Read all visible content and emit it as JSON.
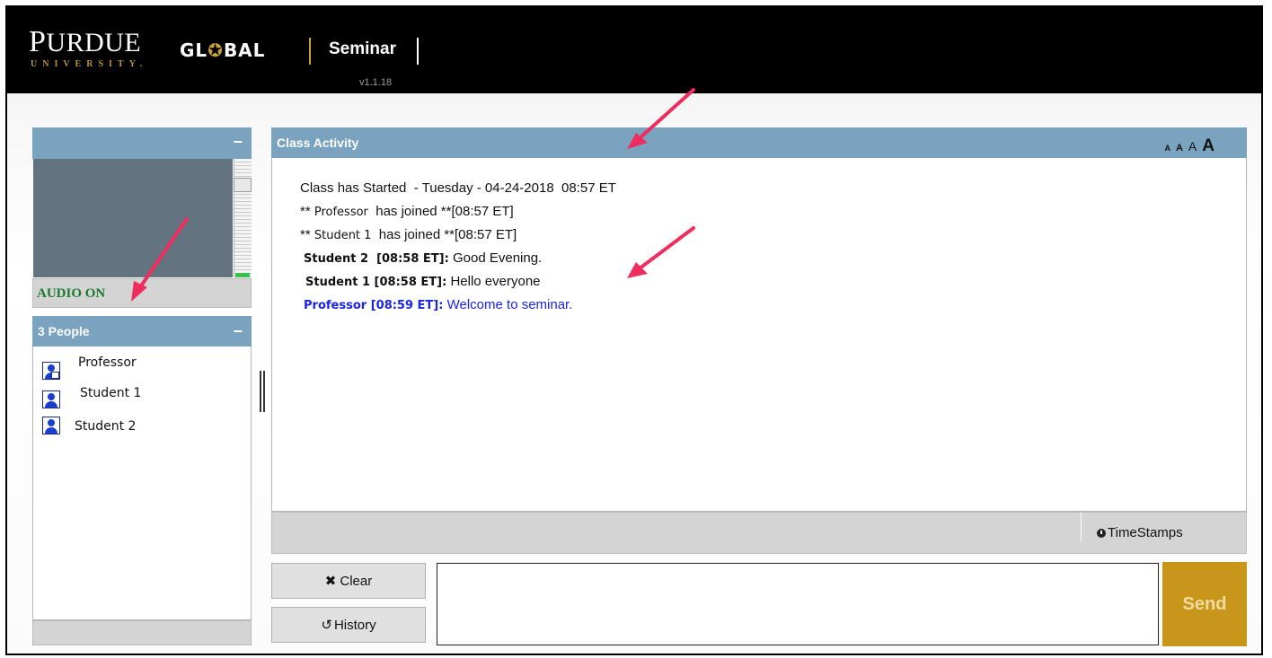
{
  "header": {
    "logo_purdue_first": "P",
    "logo_purdue_rest": "URDUE",
    "logo_university": "UNIVERSITY.",
    "logo_global_a": "GL",
    "logo_global_globe": "✪",
    "logo_global_b": "BAL",
    "app_title": "Seminar",
    "version": "v1.1.18"
  },
  "video_panel": {
    "minimize_label": "−",
    "audio_status": "AUDIO ON"
  },
  "people_panel": {
    "title": "3 People",
    "minimize_label": "−",
    "people": [
      {
        "name": "Professor",
        "icon": "presenter-icon"
      },
      {
        "name": "Student 1",
        "icon": "user-icon"
      },
      {
        "name": "Student 2",
        "icon": "user-icon"
      }
    ]
  },
  "activity_panel": {
    "title": "Class Activity",
    "font_size_options": [
      "A",
      "A",
      "A",
      "A"
    ],
    "messages": {
      "started": "Class has Started  - Tuesday - 04-24-2018  08:57 ET",
      "join1_prefix": "** ",
      "join1_name": "Professor",
      "join1_suffix": "  has joined **[08:57 ET]",
      "join2_prefix": "** ",
      "join2_name": "Student 1",
      "join2_suffix": "  has joined **[08:57 ET]",
      "m1_head": "Student 2  [08:58 ET]:",
      "m1_text": " Good Evening.",
      "m2_head": "Student 1 [08:58 ET]:",
      "m2_text": " Hello everyone",
      "m3_head": "Professor [08:59 ET]:",
      "m3_text": " Welcome to seminar."
    },
    "timestamps_label": "TimeStamps"
  },
  "controls": {
    "clear_label": "Clear",
    "clear_icon": "✖",
    "history_label": "History",
    "history_icon": "↺",
    "message_value": "",
    "send_label": "Send"
  },
  "colors": {
    "header_bg": "#000000",
    "accent_gold": "#c9a23e",
    "panel_header": "#7aa3c0",
    "send_button": "#c8961a",
    "professor_message": "#1a24e6",
    "audio_on": "#1a7a2e",
    "annotation_arrow": "#ee2e5e"
  }
}
